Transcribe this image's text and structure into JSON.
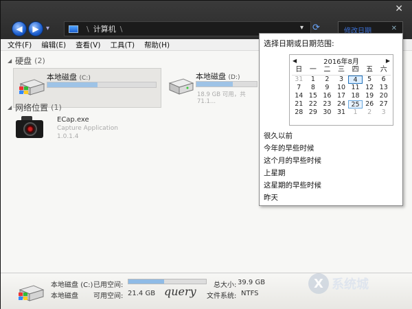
{
  "nav": {
    "back_icon": "◀",
    "forward_icon": "▶",
    "dropdown_icon": "▾"
  },
  "address": {
    "sep1": "\\",
    "crumb": "计算机",
    "sep2": "\\",
    "dropdown_icon": "▾",
    "refresh_icon": "⟳"
  },
  "search": {
    "placeholder": "修改日期",
    "clear_icon": "✕"
  },
  "window": {
    "close_icon": "✕"
  },
  "menubar": {
    "items": [
      "文件(F)",
      "编辑(E)",
      "查看(V)",
      "工具(T)",
      "帮助(H)"
    ]
  },
  "groups": {
    "disks": {
      "label": "硬盘",
      "count": "(2)"
    },
    "network": {
      "label": "网络位置",
      "count": "(1)"
    }
  },
  "drives": [
    {
      "name": "本地磁盘",
      "letter": "(C:)",
      "used_pct": 46,
      "info": ""
    },
    {
      "name": "本地磁盘",
      "letter": "(D:)",
      "used_pct": 60,
      "info": "18.9 GB 可用，共 71.1..."
    }
  ],
  "app": {
    "name": "ECap.exe",
    "desc": "Capture Application",
    "version": "1.0.1.4"
  },
  "date_popup": {
    "title": "选择日期或日期范围:",
    "month_label": "2016年8月",
    "prev_icon": "◀",
    "next_icon": "▶",
    "weekdays": [
      "日",
      "一",
      "二",
      "三",
      "四",
      "五",
      "六"
    ],
    "days": [
      [
        "31",
        "1",
        "2",
        "3",
        "4",
        "5",
        "6"
      ],
      [
        "7",
        "8",
        "9",
        "10",
        "11",
        "12",
        "13"
      ],
      [
        "14",
        "15",
        "16",
        "17",
        "18",
        "19",
        "20"
      ],
      [
        "21",
        "22",
        "23",
        "24",
        "25",
        "26",
        "27"
      ],
      [
        "28",
        "29",
        "30",
        "31",
        "1",
        "2",
        "3"
      ]
    ],
    "selected_day": "4",
    "today_day": "25",
    "presets": [
      "很久以前",
      "今年的早些时候",
      "这个月的早些时候",
      "上星期",
      "这星期的早些时候",
      "昨天"
    ]
  },
  "details": {
    "name": "本地磁盘",
    "letter": "(C:)",
    "used_label": "已用空间:",
    "used_pct": 46,
    "free_label": "可用空间:",
    "free_value": "21.4 GB",
    "total_label": "总大小:",
    "total_value": "39.9 GB",
    "fs_label": "文件系统:",
    "fs_value": "NTFS"
  },
  "watermark": {
    "logo": "X",
    "text": "系统城",
    "sub": "XITONGCHENG.COM"
  },
  "signature": "query"
}
